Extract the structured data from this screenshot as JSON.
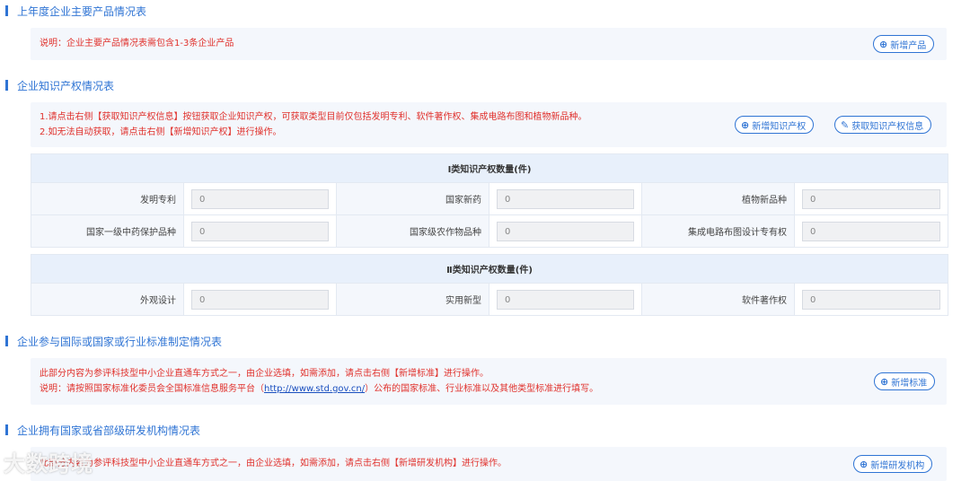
{
  "sections": {
    "products": {
      "title": "上年度企业主要产品情况表",
      "note": "说明：企业主要产品情况表需包含1-3条企业产品",
      "add_button": "新增产品"
    },
    "ip": {
      "title": "企业知识产权情况表",
      "note_line1": "1.请点击右侧【获取知识产权信息】按钮获取企业知识产权，可获取类型目前仅包括发明专利、软件著作权、集成电路布图和植物新品种。",
      "note_line2": "2.如无法自动获取，请点击右侧【新增知识产权】进行操作。",
      "add_button": "新增知识产权",
      "fetch_button": "获取知识产权信息",
      "class1_header": "Ⅰ类知识产权数量(件)",
      "class1_rows": [
        [
          {
            "label": "发明专利",
            "value": "0"
          },
          {
            "label": "国家新药",
            "value": "0"
          },
          {
            "label": "植物新品种",
            "value": "0"
          }
        ],
        [
          {
            "label": "国家一级中药保护品种",
            "value": "0"
          },
          {
            "label": "国家级农作物品种",
            "value": "0"
          },
          {
            "label": "集成电路布图设计专有权",
            "value": "0"
          }
        ]
      ],
      "class2_header": "Ⅱ类知识产权数量(件)",
      "class2_rows": [
        [
          {
            "label": "外观设计",
            "value": "0"
          },
          {
            "label": "实用新型",
            "value": "0"
          },
          {
            "label": "软件著作权",
            "value": "0"
          }
        ]
      ]
    },
    "standards": {
      "title": "企业参与国际或国家或行业标准制定情况表",
      "note_line1": "此部分内容为参评科技型中小企业直通车方式之一，由企业选填，如需添加，请点击右侧【新增标准】进行操作。",
      "note_line2_prefix": "说明：请按照国家标准化委员会全国标准信息服务平台（",
      "note_line2_link": "http://www.std.gov.cn/",
      "note_line2_suffix": "）公布的国家标准、行业标准以及其他类型标准进行填写。",
      "add_button": "新增标准"
    },
    "rnd": {
      "title": "企业拥有国家或省部级研发机构情况表",
      "note_line1": "此部分内容为参评科技型中小企业直通车方式之一，由企业选填，如需添加，请点击右侧【新增研发机构】进行操作。",
      "add_button": "新增研发机构"
    }
  },
  "watermark": "大数跨境",
  "colors": {
    "accent": "#2f74d4",
    "note_red": "#e0312c",
    "box_bg": "#f4f7fc",
    "header_bg": "#e8f0fb"
  }
}
